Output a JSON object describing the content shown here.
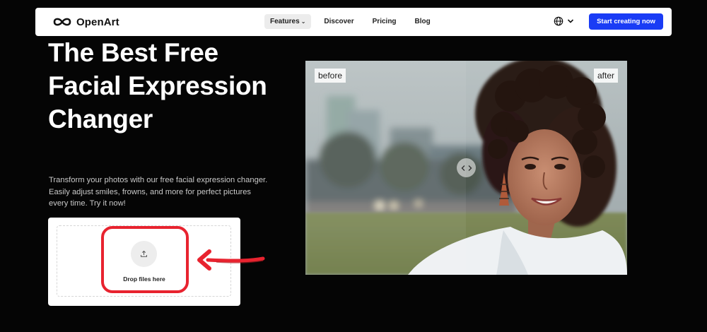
{
  "nav": {
    "logo_text": "OpenArt",
    "links": [
      {
        "label": "Features",
        "has_dropdown": true
      },
      {
        "label": "Discover"
      },
      {
        "label": "Pricing"
      },
      {
        "label": "Blog"
      }
    ],
    "language_icon": "globe-icon",
    "cta_label": "Start creating now",
    "cta_color": "#1a3cf5"
  },
  "hero": {
    "title": "The Best Free Facial Expression Changer",
    "description": "Transform your photos with our free facial expression changer. Easily adjust smiles, frowns, and more for perfect pictures every time. Try it now!"
  },
  "upload": {
    "label": "Drop files here",
    "icon": "upload-icon"
  },
  "annotation": {
    "highlight_color": "#e8232f"
  },
  "compare": {
    "before_label": "before",
    "after_label": "after",
    "handle_icon": "chevron-left-right-icon"
  }
}
